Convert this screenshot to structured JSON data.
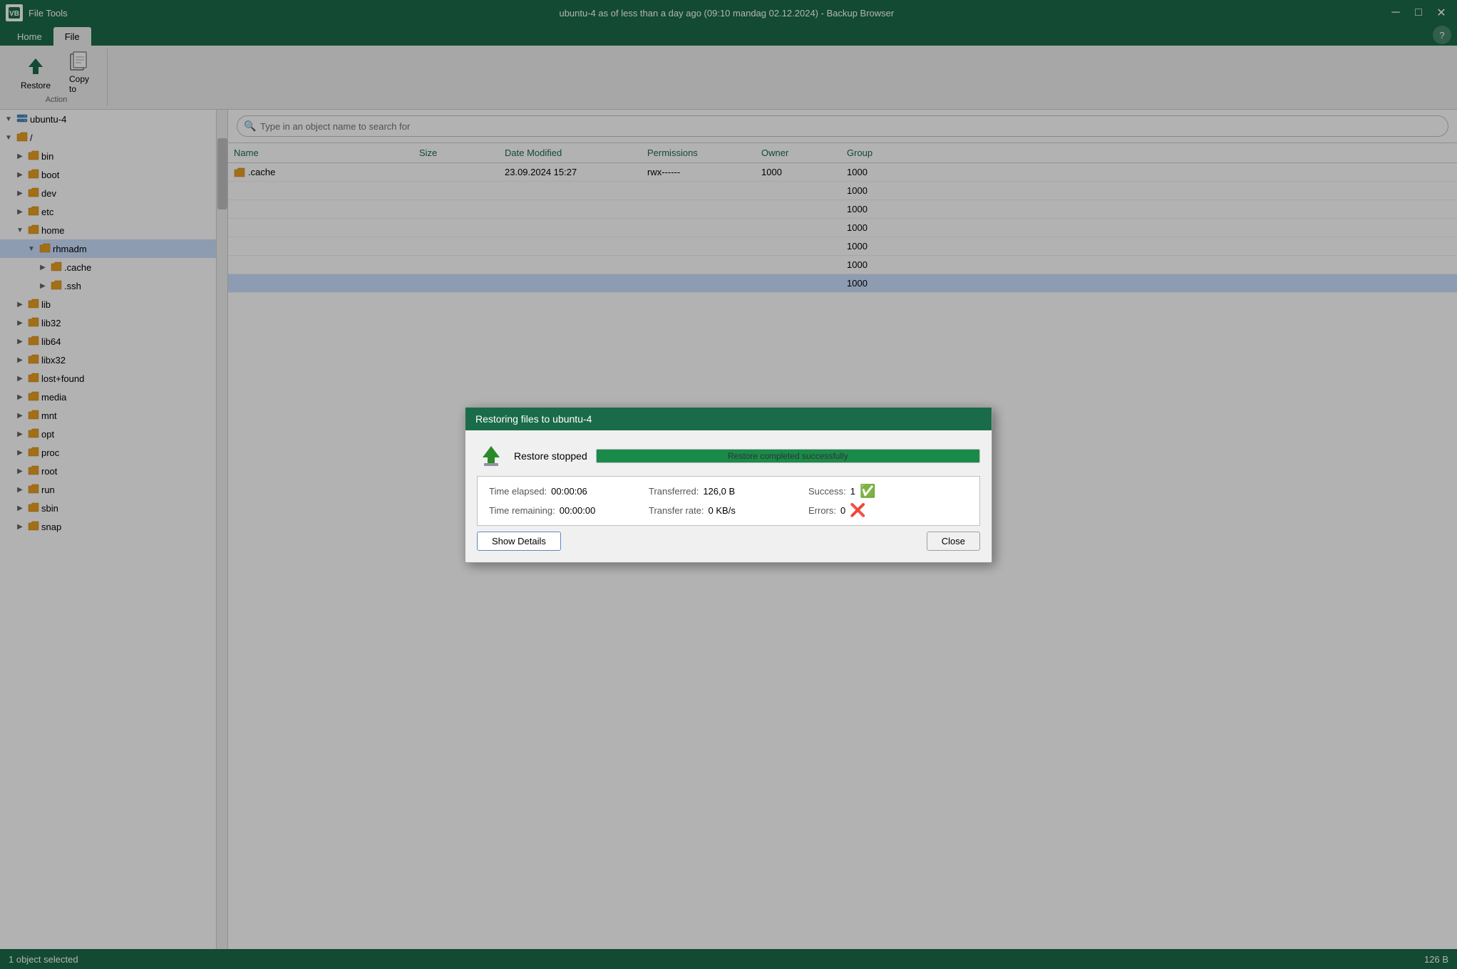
{
  "titlebar": {
    "logo": "VB",
    "app": "File Tools",
    "title": "ubuntu-4 as of less than a day ago (09:10 mandag 02.12.2024) - Backup Browser",
    "minimize": "─",
    "maximize": "□",
    "close": "✕"
  },
  "ribbon": {
    "tabs": [
      {
        "id": "home",
        "label": "Home"
      },
      {
        "id": "file",
        "label": "File"
      }
    ],
    "active_tab": "File",
    "groups": [
      {
        "id": "action",
        "label": "Action",
        "buttons": [
          {
            "id": "restore",
            "label": "Restore",
            "icon": "⬆",
            "type": "up"
          },
          {
            "id": "copy-to",
            "label": "Copy\nto",
            "icon": "📄",
            "type": "doc"
          }
        ]
      }
    ],
    "help_label": "?"
  },
  "sidebar": {
    "items": [
      {
        "id": "ubuntu4",
        "label": "ubuntu-4",
        "indent": 0,
        "icon": "server",
        "toggle": "▼",
        "level": 0
      },
      {
        "id": "root",
        "label": "/",
        "indent": 1,
        "icon": "folder",
        "toggle": "▼",
        "level": 1
      },
      {
        "id": "bin",
        "label": "bin",
        "indent": 2,
        "icon": "folder",
        "toggle": "▶",
        "level": 2
      },
      {
        "id": "boot",
        "label": "boot",
        "indent": 2,
        "icon": "folder",
        "toggle": "▶",
        "level": 2
      },
      {
        "id": "dev",
        "label": "dev",
        "indent": 2,
        "icon": "folder",
        "toggle": "▶",
        "level": 2
      },
      {
        "id": "etc",
        "label": "etc",
        "indent": 2,
        "icon": "folder",
        "toggle": "▶",
        "level": 2
      },
      {
        "id": "home",
        "label": "home",
        "indent": 2,
        "icon": "folder",
        "toggle": "▼",
        "level": 2
      },
      {
        "id": "rhmadm",
        "label": "rhmadm",
        "indent": 3,
        "icon": "folder",
        "toggle": "▼",
        "level": 3,
        "selected": true
      },
      {
        "id": "cache",
        "label": ".cache",
        "indent": 4,
        "icon": "folder",
        "toggle": "▶",
        "level": 4
      },
      {
        "id": "ssh",
        "label": ".ssh",
        "indent": 4,
        "icon": "folder",
        "toggle": "▶",
        "level": 4
      },
      {
        "id": "lib",
        "label": "lib",
        "indent": 2,
        "icon": "folder",
        "toggle": "▶",
        "level": 2
      },
      {
        "id": "lib32",
        "label": "lib32",
        "indent": 2,
        "icon": "folder",
        "toggle": "▶",
        "level": 2
      },
      {
        "id": "lib64",
        "label": "lib64",
        "indent": 2,
        "icon": "folder",
        "toggle": "▶",
        "level": 2
      },
      {
        "id": "libx32",
        "label": "libx32",
        "indent": 2,
        "icon": "folder",
        "toggle": "▶",
        "level": 2
      },
      {
        "id": "lost-found",
        "label": "lost+found",
        "indent": 2,
        "icon": "folder",
        "toggle": "▶",
        "level": 2
      },
      {
        "id": "media",
        "label": "media",
        "indent": 2,
        "icon": "folder",
        "toggle": "▶",
        "level": 2
      },
      {
        "id": "mnt",
        "label": "mnt",
        "indent": 2,
        "icon": "folder",
        "toggle": "▶",
        "level": 2
      },
      {
        "id": "opt",
        "label": "opt",
        "indent": 2,
        "icon": "folder",
        "toggle": "▶",
        "level": 2
      },
      {
        "id": "proc",
        "label": "proc",
        "indent": 2,
        "icon": "folder",
        "toggle": "▶",
        "level": 2
      },
      {
        "id": "root",
        "label": "root",
        "indent": 2,
        "icon": "folder",
        "toggle": "▶",
        "level": 2
      },
      {
        "id": "run",
        "label": "run",
        "indent": 2,
        "icon": "folder",
        "toggle": "▶",
        "level": 2
      },
      {
        "id": "sbin",
        "label": "sbin",
        "indent": 2,
        "icon": "folder",
        "toggle": "▶",
        "level": 2
      },
      {
        "id": "snap",
        "label": "snap",
        "indent": 2,
        "icon": "folder",
        "toggle": "▶",
        "level": 2
      }
    ]
  },
  "file_list": {
    "columns": [
      {
        "id": "name",
        "label": "Name"
      },
      {
        "id": "size",
        "label": "Size"
      },
      {
        "id": "date",
        "label": "Date Modified"
      },
      {
        "id": "permissions",
        "label": "Permissions"
      },
      {
        "id": "owner",
        "label": "Owner"
      },
      {
        "id": "group",
        "label": "Group"
      }
    ],
    "rows": [
      {
        "name": ".cache",
        "size": "",
        "date": "23.09.2024 15:27",
        "permissions": "rwx------",
        "owner": "1000",
        "group": "1000",
        "selected": false
      },
      {
        "name": "",
        "size": "",
        "date": "",
        "permissions": "",
        "owner": "",
        "group": "1000",
        "selected": false
      },
      {
        "name": "",
        "size": "",
        "date": "",
        "permissions": "",
        "owner": "",
        "group": "1000",
        "selected": false
      },
      {
        "name": "",
        "size": "",
        "date": "",
        "permissions": "",
        "owner": "",
        "group": "1000",
        "selected": false
      },
      {
        "name": "",
        "size": "",
        "date": "",
        "permissions": "",
        "owner": "",
        "group": "1000",
        "selected": false
      },
      {
        "name": "",
        "size": "",
        "date": "",
        "permissions": "",
        "owner": "",
        "group": "1000",
        "selected": false
      },
      {
        "name": "",
        "size": "",
        "date": "",
        "permissions": "",
        "owner": "",
        "group": "1000",
        "selected": true
      }
    ],
    "search_placeholder": "Type in an object name to search for"
  },
  "modal": {
    "title": "Restoring files to ubuntu-4",
    "status": "Restore stopped",
    "progress_text": "Restore completed successfully",
    "progress_pct": 100,
    "stats": {
      "time_elapsed_label": "Time elapsed:",
      "time_elapsed_value": "00:00:06",
      "transferred_label": "Transferred:",
      "transferred_value": "126,0 B",
      "success_label": "Success:",
      "success_value": "1",
      "time_remaining_label": "Time remaining:",
      "time_remaining_value": "00:00:00",
      "transfer_rate_label": "Transfer rate:",
      "transfer_rate_value": "0 KB/s",
      "errors_label": "Errors:",
      "errors_value": "0"
    },
    "show_details_label": "Show Details",
    "close_label": "Close"
  },
  "statusbar": {
    "left": "1 object selected",
    "right": "126 B"
  },
  "colors": {
    "header_bg": "#1a6b4a",
    "accent": "#1a6b4a",
    "folder": "#e8a020",
    "selected_row": "#cce0ff"
  }
}
